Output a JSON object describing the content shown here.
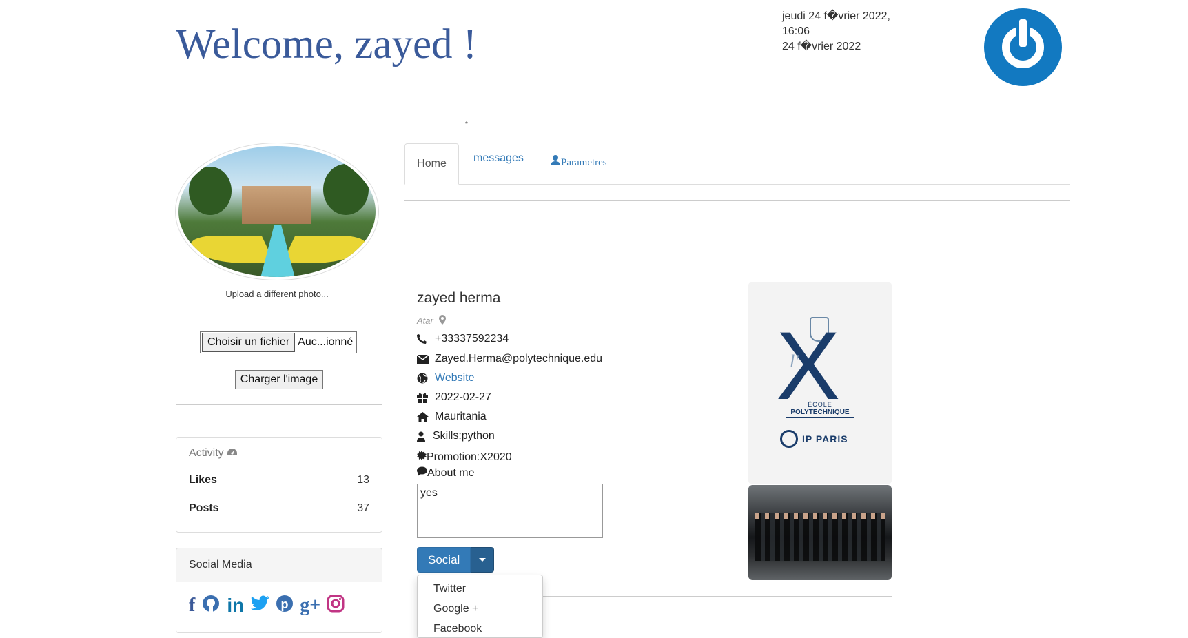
{
  "header": {
    "welcome": "Welcome, zayed !",
    "date_line1": "jeudi 24 f�vrier 2022,",
    "time": "16:06",
    "date_line2": "24 f�vrier 2022",
    "stray": "*"
  },
  "sidebar": {
    "upload_label": "Upload a different photo...",
    "file_button": "Choisir un fichier",
    "file_name": "Auc...ionné",
    "load_button": "Charger l'image",
    "activity": {
      "title": "Activity",
      "rows": [
        {
          "label": "Likes",
          "value": "13"
        },
        {
          "label": "Posts",
          "value": "37"
        }
      ]
    },
    "social_media": {
      "title": "Social Media",
      "icons": [
        "facebook-icon",
        "github-icon",
        "linkedin-icon",
        "twitter-icon",
        "pinterest-icon",
        "google-plus-icon",
        "instagram-icon"
      ]
    }
  },
  "tabs": [
    {
      "label": "Home",
      "active": true
    },
    {
      "label": "messages"
    },
    {
      "label": "Parametres",
      "icon": "user-icon"
    }
  ],
  "profile": {
    "name": "zayed herma",
    "city": "Atar",
    "phone": "+33337592234",
    "email": "Zayed.Herma@polytechnique.edu",
    "website": "Website",
    "birthday": "2022-02-27",
    "country": "Mauritania",
    "skills": "Skills:python",
    "promotion": "Promotion:X2020",
    "about_label": "About me",
    "about_text": "yes"
  },
  "social_dropdown": {
    "button": "Social",
    "items": [
      "Twitter",
      "Google +",
      "Facebook"
    ]
  },
  "school_logo": {
    "ecole": "ÉCOLE",
    "polytechnique": "POLYTECHNIQUE",
    "ip_paris": "IP PARIS"
  },
  "colors": {
    "welcome": "#3a5a9a",
    "link": "#337ab7",
    "power_logo": "#1279c1"
  }
}
